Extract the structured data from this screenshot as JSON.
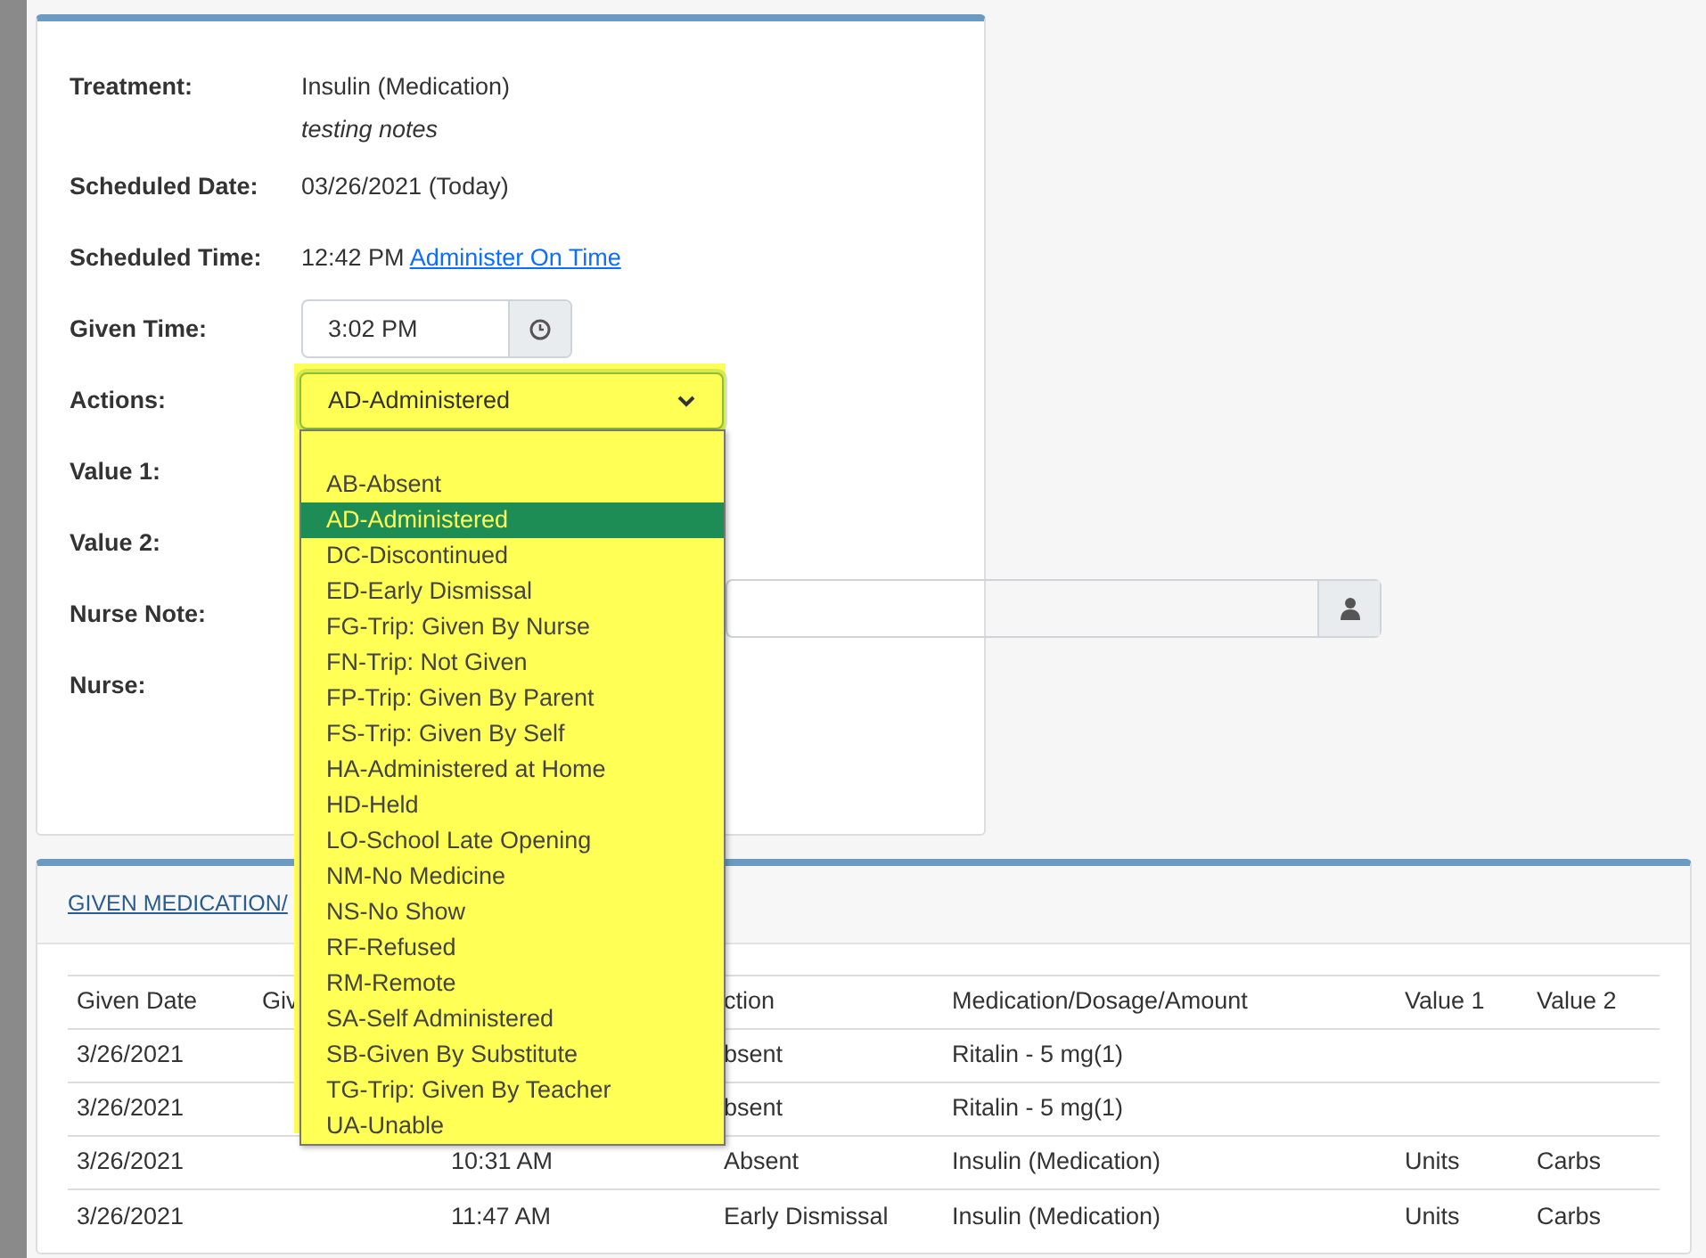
{
  "form": {
    "fields": [
      {
        "label": "Treatment:",
        "kind": "text",
        "value": "Insulin (Medication)",
        "note": "testing notes"
      },
      {
        "label": "Scheduled Date:",
        "kind": "text",
        "value": "03/26/2021 (Today)"
      },
      {
        "label": "Scheduled Time:",
        "kind": "text",
        "value": "12:42 PM",
        "link": "Administer On Time"
      },
      {
        "label": "Given Time:",
        "kind": "time",
        "value": "3:02 PM"
      },
      {
        "label": "Actions:",
        "kind": "select",
        "value": "AD-Administered",
        "expanded": true,
        "options": [
          {
            "label": "AB-Absent",
            "selected": false
          },
          {
            "label": "AD-Administered",
            "selected": true
          },
          {
            "label": "DC-Discontinued",
            "selected": false
          },
          {
            "label": "ED-Early Dismissal",
            "selected": false
          },
          {
            "label": "FG-Trip: Given By Nurse",
            "selected": false
          },
          {
            "label": "FN-Trip: Not Given",
            "selected": false
          },
          {
            "label": "FP-Trip: Given By Parent",
            "selected": false
          },
          {
            "label": "FS-Trip: Given By Self",
            "selected": false
          },
          {
            "label": "HA-Administered at Home",
            "selected": false
          },
          {
            "label": "HD-Held",
            "selected": false
          },
          {
            "label": "LO-School Late Opening",
            "selected": false
          },
          {
            "label": "NM-No Medicine",
            "selected": false
          },
          {
            "label": "NS-No Show",
            "selected": false
          },
          {
            "label": "RF-Refused",
            "selected": false
          },
          {
            "label": "RM-Remote",
            "selected": false
          },
          {
            "label": "SA-Self Administered",
            "selected": false
          },
          {
            "label": "SB-Given By Substitute",
            "selected": false
          },
          {
            "label": "TG-Trip: Given By Teacher",
            "selected": false
          },
          {
            "label": "UA-Unable",
            "selected": false
          }
        ]
      },
      {
        "label": "Value 1:",
        "kind": "covered"
      },
      {
        "label": "Value 2:",
        "kind": "covered"
      },
      {
        "label": "Nurse Note:",
        "kind": "note"
      },
      {
        "label": "Nurse:",
        "kind": "covered"
      }
    ]
  },
  "given_medication": {
    "title": "GIVEN MEDICATION/",
    "columns": [
      {
        "label": "Given Date"
      },
      {
        "label": "Giv"
      },
      {},
      {
        "label": "ction"
      },
      {
        "label": "Medication/Dosage/Amount"
      },
      {
        "label": "Value 1"
      },
      {
        "label": "Value 2"
      }
    ],
    "rows": [
      [
        "3/26/2021",
        null,
        null,
        "bsent",
        "Ritalin - 5 mg(1)",
        null,
        null
      ],
      [
        "3/26/2021",
        null,
        null,
        "bsent",
        "Ritalin - 5 mg(1)",
        null,
        null
      ],
      [
        "3/26/2021",
        null,
        "10:31 AM",
        "Absent",
        "Insulin (Medication)",
        "Units",
        "Carbs"
      ],
      [
        "3/26/2021",
        null,
        "11:47 AM",
        "Early Dismissal",
        "Insulin (Medication)",
        "Units",
        "Carbs"
      ]
    ]
  }
}
